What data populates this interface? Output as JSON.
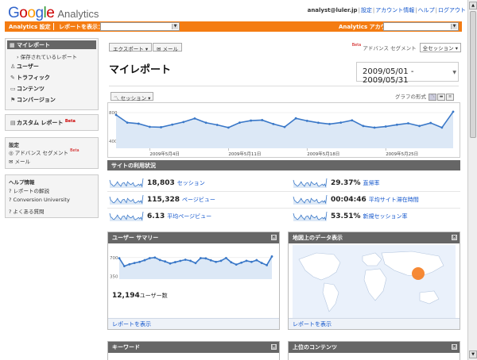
{
  "header": {
    "logo_word": [
      "G",
      "o",
      "o",
      "g",
      "l",
      "e"
    ],
    "product": "Analytics",
    "user_email": "analyst@luler.jp",
    "links": [
      "設定",
      "アカウント情報",
      "ヘルプ",
      "ログアウト"
    ]
  },
  "topbar": {
    "settings_label": "Analytics 設定",
    "report_label": "レポートを表示：",
    "account_label": "Analytics アカウント："
  },
  "sidebar": {
    "my_report": "マイレポート",
    "saved_reports": "保存されているレポート",
    "nav": [
      {
        "icon": "user-icon",
        "glyph": "♙",
        "label": "ユーザー"
      },
      {
        "icon": "traffic-icon",
        "glyph": "✎",
        "label": "トラフィック"
      },
      {
        "icon": "content-icon",
        "glyph": "▭",
        "label": "コンテンツ"
      },
      {
        "icon": "flag-icon",
        "glyph": "⚑",
        "label": "コンバージョン"
      }
    ],
    "custom_report": "カスタム レポート",
    "beta": "Beta",
    "settings_heading": "設定",
    "advanced_segment": "アドバンス セグメント",
    "email": "メール",
    "help_heading": "ヘルプ情報",
    "help_items": [
      "レポートの解説",
      "Conversion University",
      "よくある質問"
    ]
  },
  "toolbar": {
    "export_label": "エクスポート",
    "email_label": "メール",
    "beta": "Beta",
    "segment_label": "アドバンス セグメント",
    "segment_value": "全セッション"
  },
  "page_title": "マイレポート",
  "date_range": "2009/05/01 - 2009/05/31",
  "graph": {
    "metric_button": "セッション",
    "format_label": "グラフの形式"
  },
  "chart_data": [
    {
      "type": "line",
      "ylim": [
        300,
        900
      ],
      "yticks": [
        400,
        800
      ],
      "x_labels": [
        "2009年5月4日",
        "2009年5月11日",
        "2009年5月18日",
        "2009年5月25日"
      ],
      "x_label_positions": [
        3,
        10,
        17,
        24
      ],
      "values": [
        768,
        660,
        645,
        600,
        595,
        632,
        668,
        718,
        658,
        628,
        590,
        660,
        688,
        695,
        640,
        598,
        720,
        685,
        658,
        640,
        660,
        692,
        612,
        590,
        605,
        630,
        650,
        612,
        655,
        590,
        812
      ]
    },
    {
      "type": "line",
      "ylim": [
        300,
        800
      ],
      "yticks": [
        350,
        700
      ],
      "values": [
        688,
        540,
        575,
        600,
        620,
        652,
        690,
        700,
        655,
        628,
        590,
        615,
        638,
        660,
        640,
        598,
        690,
        685,
        650,
        620,
        640,
        692,
        612,
        570,
        605,
        640,
        620,
        652,
        600,
        560,
        720
      ]
    }
  ],
  "site_usage": {
    "title": "サイトの利用状況",
    "metrics": [
      {
        "value": "18,803",
        "label": "セッション"
      },
      {
        "value": "29.37%",
        "label": "直帰率"
      },
      {
        "value": "115,328",
        "label": "ページビュー"
      },
      {
        "value": "00:04:46",
        "label": "平均サイト滞在時間"
      },
      {
        "value": "6.13",
        "label": "平均ページビュー"
      },
      {
        "value": "53.51%",
        "label": "新規セッション率"
      }
    ]
  },
  "widgets": {
    "user_summary": {
      "title": "ユーザー サマリー",
      "count": "12,194",
      "count_label": "ユーザー数",
      "footer": "レポートを表示"
    },
    "map_overlay": {
      "title": "地図上のデータ表示",
      "footer": "レポートを表示"
    },
    "keywords": {
      "title": "キーワード"
    },
    "top_content": {
      "title": "上位のコンテンツ"
    }
  },
  "colors": {
    "orange": "#f47c12",
    "line": "#3a78c8",
    "fill": "#dce8f6",
    "bar": "#666666"
  }
}
